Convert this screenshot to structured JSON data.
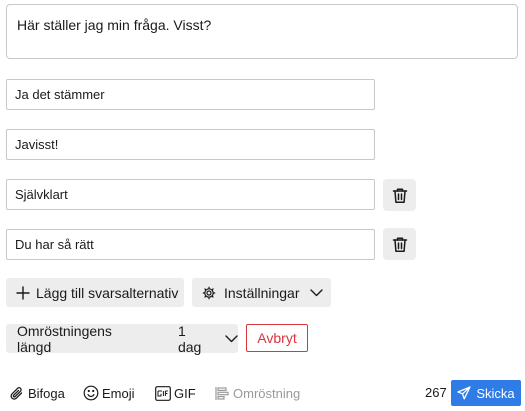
{
  "question": {
    "text": "Här ställer jag min fråga. Visst?"
  },
  "options": [
    {
      "text": "Ja det stämmer",
      "deletable": false
    },
    {
      "text": "Javisst!",
      "deletable": false
    },
    {
      "text": "Självklart",
      "deletable": true
    },
    {
      "text": "Du har så rätt",
      "deletable": true
    }
  ],
  "actions": {
    "add_option_label": "Lägg till svarsalternativ",
    "settings_label": "Inställningar"
  },
  "duration": {
    "label": "Omröstningens längd",
    "value": "1 dag",
    "cancel_label": "Avbryt"
  },
  "toolbar": {
    "attach_label": "Bifoga",
    "emoji_label": "Emoji",
    "gif_label": "GIF",
    "poll_label": "Omröstning",
    "char_count": "267",
    "send_label": "Skicka"
  },
  "colors": {
    "accent": "#2f7ce6",
    "danger": "#d9363e",
    "button_bg": "#ededed"
  }
}
